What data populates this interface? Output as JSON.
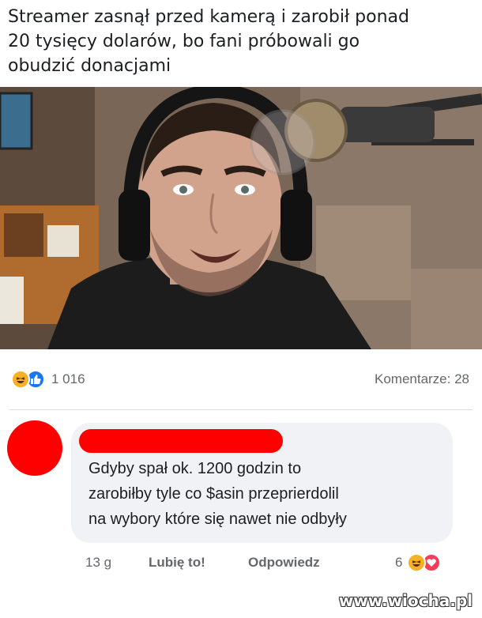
{
  "post": {
    "headline": "Streamer zasnął przed kamerą i zarobił ponad\n20 tysięcy dolarów, bo fani próbowali go\nobudzić donacjami",
    "photo_alt": "streamer-with-headphones-and-microphone"
  },
  "stats": {
    "reaction_icons": [
      "haha-emoji-icon",
      "like-thumb-icon"
    ],
    "reaction_count": "1 016",
    "comments_label": "Komentarze: 28"
  },
  "comment": {
    "author_redacted": true,
    "text": "Gdyby spał ok. 1200 godzin to\nzarobiłby tyle co $asin przeprierdolil\nna wybory które się nawet nie odbyły",
    "time": "13 g",
    "like_label": "Lubię to!",
    "reply_label": "Odpowiedz",
    "reaction_count": "6",
    "reaction_icons": [
      "haha-emoji-icon",
      "heart-icon"
    ]
  },
  "colors": {
    "redaction": "#ff0000",
    "like_blue": "#1877f2",
    "haha_yellow": "#f7b125",
    "love_red": "#f33e58",
    "bubble_bg": "#f0f2f5"
  },
  "watermark": "www.wiocha.pl"
}
